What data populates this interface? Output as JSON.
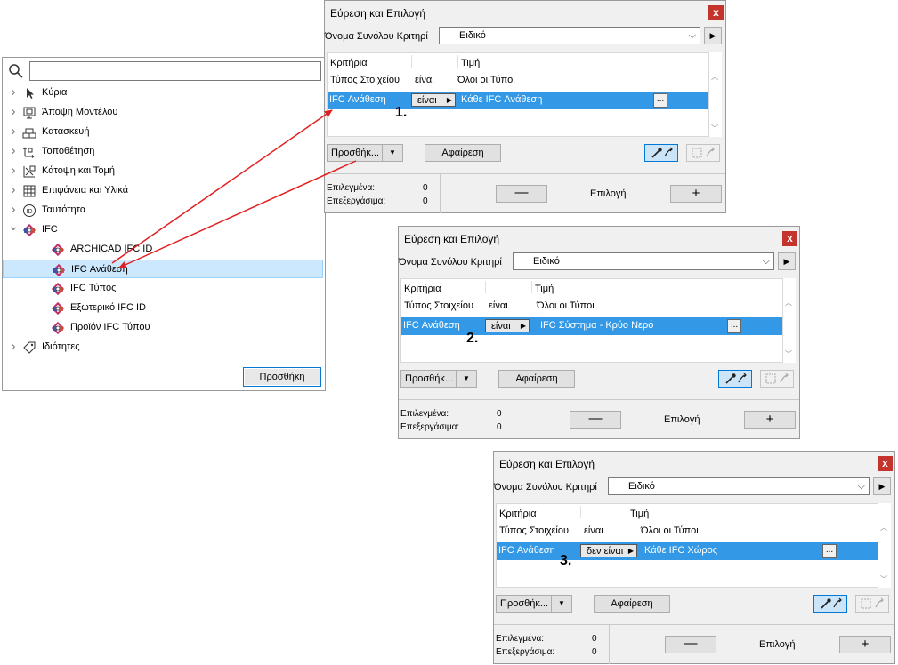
{
  "tree": {
    "search_placeholder": "",
    "items": [
      {
        "label": "Κύρια",
        "icon": "cursor-arrow-icon",
        "expander": ">"
      },
      {
        "label": "Άποψη Μοντέλου",
        "icon": "monitor-icon",
        "expander": ">"
      },
      {
        "label": "Κατασκευή",
        "icon": "bricks-icon",
        "expander": ">"
      },
      {
        "label": "Τοποθέτηση",
        "icon": "placement-icon",
        "expander": ">"
      },
      {
        "label": "Κάτοψη και Τομή",
        "icon": "floor-plan-icon",
        "expander": ">"
      },
      {
        "label": "Επιφάνεια και Υλικά",
        "icon": "surface-icon",
        "expander": ">"
      },
      {
        "label": "Ταυτότητα",
        "icon": "id-icon",
        "expander": ">"
      },
      {
        "label": "IFC",
        "icon": "ifc-icon",
        "expander": "v"
      },
      {
        "label": "ARCHICAD IFC ID",
        "icon": "ifc-icon",
        "expander": ""
      },
      {
        "label": "IFC Ανάθεση",
        "icon": "ifc-icon",
        "expander": ""
      },
      {
        "label": "IFC Τύπος",
        "icon": "ifc-icon",
        "expander": ""
      },
      {
        "label": "Εξωτερικό IFC ID",
        "icon": "ifc-icon",
        "expander": ""
      },
      {
        "label": "Προϊόν IFC Τύπου",
        "icon": "ifc-icon",
        "expander": ""
      },
      {
        "label": "Ιδιότητες",
        "icon": "tag-icon",
        "expander": ">"
      }
    ],
    "add_button": "Προσθήκη"
  },
  "dialogs": [
    {
      "title": "Εύρεση και Επιλογή",
      "close": "x",
      "set_label": "Όνομα Συνόλου Κριτηρί",
      "set_value": "Ειδικό",
      "headers": {
        "criteria": "Κριτήρια",
        "value": "Τιμή"
      },
      "row1": {
        "type": "Τύπος Στοιχείου",
        "op": "είναι",
        "value": "Όλοι οι Τύποι"
      },
      "row2": {
        "name": "IFC Ανάθεση",
        "op": "είναι",
        "value": "Κάθε IFC Ανάθεση",
        "more": "..."
      },
      "add": "Προσθήκ...",
      "remove": "Αφαίρεση",
      "selected_label": "Επιλεγμένα:",
      "selected_value": "0",
      "editable_label": "Επεξεργάσιμα:",
      "editable_value": "0",
      "minus": "—",
      "selection": "Επιλογή",
      "plus": "+",
      "step": "1."
    },
    {
      "title": "Εύρεση και Επιλογή",
      "close": "x",
      "set_label": "Όνομα Συνόλου Κριτηρί",
      "set_value": "Ειδικό",
      "headers": {
        "criteria": "Κριτήρια",
        "value": "Τιμή"
      },
      "row1": {
        "type": "Τύπος Στοιχείου",
        "op": "είναι",
        "value": "Όλοι οι Τύποι"
      },
      "row2": {
        "name": "IFC Ανάθεση",
        "op": "είναι",
        "value": "IFC Σύστημα - Κρύο Νερό",
        "more": "..."
      },
      "add": "Προσθήκ...",
      "remove": "Αφαίρεση",
      "selected_label": "Επιλεγμένα:",
      "selected_value": "0",
      "editable_label": "Επεξεργάσιμα:",
      "editable_value": "0",
      "minus": "—",
      "selection": "Επιλογή",
      "plus": "+",
      "step": "2."
    },
    {
      "title": "Εύρεση και Επιλογή",
      "close": "x",
      "set_label": "Όνομα Συνόλου Κριτηρί",
      "set_value": "Ειδικό",
      "headers": {
        "criteria": "Κριτήρια",
        "value": "Τιμή"
      },
      "row1": {
        "type": "Τύπος Στοιχείου",
        "op": "είναι",
        "value": "Όλοι οι Τύποι"
      },
      "row2": {
        "name": "IFC Ανάθεση",
        "op": "δεν είναι",
        "value": "Κάθε IFC Χώρος",
        "more": "..."
      },
      "add": "Προσθήκ...",
      "remove": "Αφαίρεση",
      "selected_label": "Επιλεγμένα:",
      "selected_value": "0",
      "editable_label": "Επεξεργάσιμα:",
      "editable_value": "0",
      "minus": "—",
      "selection": "Επιλογή",
      "plus": "+",
      "step": "3."
    }
  ],
  "colors": {
    "selection_row": "#3399e6",
    "arrow": "#e02020",
    "close_button": "#c4342c",
    "tree_selected": "#cce8ff"
  }
}
